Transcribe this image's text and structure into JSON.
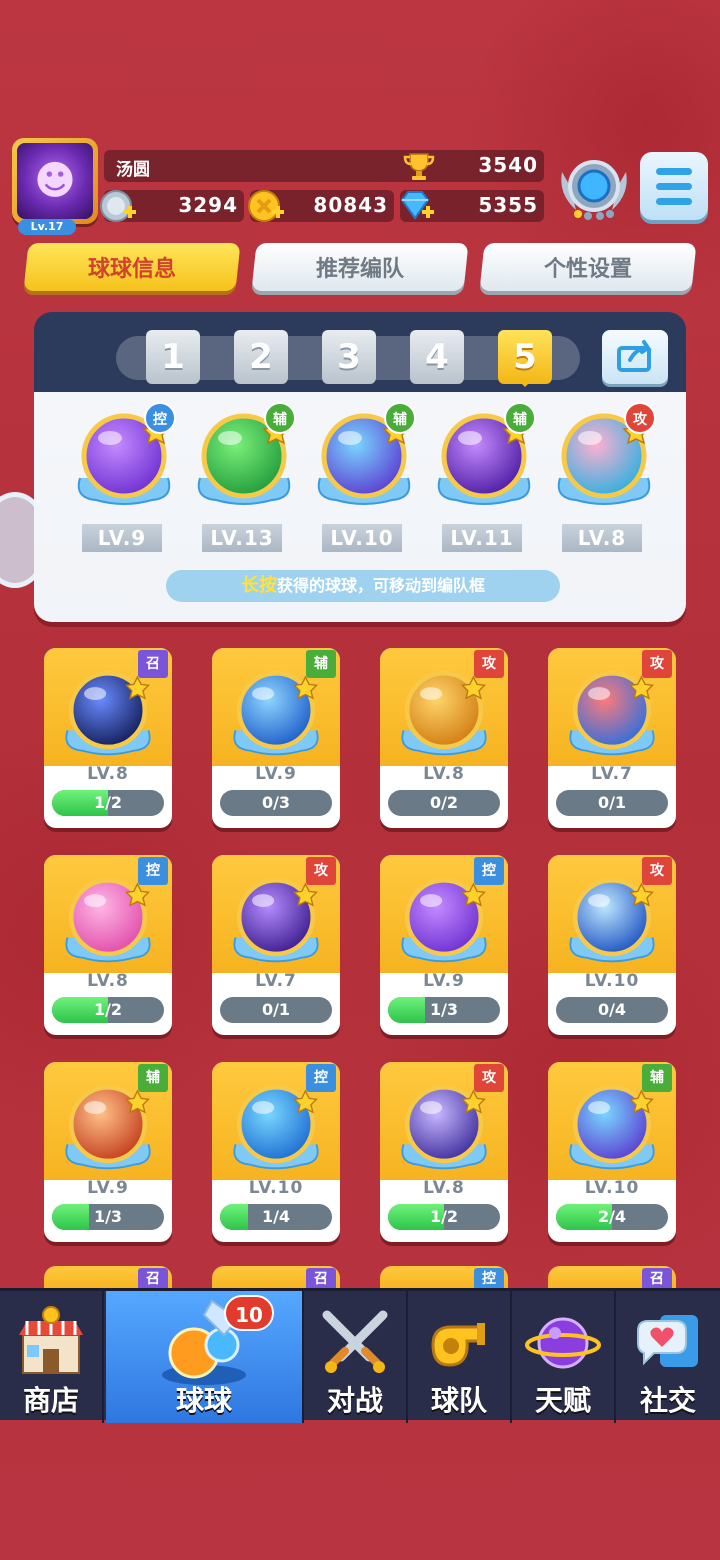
{
  "player": {
    "name": "汤圆",
    "level": "Lv.17",
    "trophies": "3540",
    "silver": "3294",
    "gold": "80843",
    "diamonds": "5355"
  },
  "tabs": [
    "球球信息",
    "推荐编队",
    "个性设置"
  ],
  "team": {
    "slots": [
      "1",
      "2",
      "3",
      "4",
      "5"
    ],
    "active_slot": "5",
    "balls": [
      {
        "tag": "控",
        "level": "LV.9",
        "icon": "butterfly-ball-icon"
      },
      {
        "tag": "辅",
        "level": "LV.13",
        "icon": "star-arrow-ball-icon"
      },
      {
        "tag": "辅",
        "level": "LV.10",
        "icon": "figures-ball-icon"
      },
      {
        "tag": "辅",
        "level": "LV.11",
        "icon": "leaf-ball-icon"
      },
      {
        "tag": "攻",
        "level": "LV.8",
        "icon": "prism-ball-icon"
      }
    ],
    "hint_highlight": "长按",
    "hint_text": "获得的球球，可移动到编队框"
  },
  "tag_colors": {
    "控": "#3a8fe0",
    "辅": "#4aad3a",
    "攻": "#e0453a",
    "召": "#7b55d9"
  },
  "cards": [
    {
      "tag": "召",
      "level": "LV.8",
      "progress": "1/2",
      "fill": 0.5,
      "icon": "void-ball-icon"
    },
    {
      "tag": "辅",
      "level": "LV.9",
      "progress": "0/3",
      "fill": 0,
      "icon": "ice-crystal-ball-icon"
    },
    {
      "tag": "攻",
      "level": "LV.8",
      "progress": "0/2",
      "fill": 0,
      "icon": "knight-ball-icon"
    },
    {
      "tag": "攻",
      "level": "LV.7",
      "progress": "0/1",
      "fill": 0,
      "icon": "yinyang-ball-icon"
    },
    {
      "tag": "控",
      "level": "LV.8",
      "progress": "1/2",
      "fill": 0.5,
      "icon": "heart-ball-icon"
    },
    {
      "tag": "攻",
      "level": "LV.7",
      "progress": "0/1",
      "fill": 0,
      "icon": "sword-ball-icon"
    },
    {
      "tag": "控",
      "level": "LV.9",
      "progress": "1/3",
      "fill": 0.33,
      "icon": "butterfly-ball-icon"
    },
    {
      "tag": "攻",
      "level": "LV.10",
      "progress": "0/4",
      "fill": 0,
      "icon": "vortex-ball-icon"
    },
    {
      "tag": "辅",
      "level": "LV.9",
      "progress": "1/3",
      "fill": 0.33,
      "icon": "wings-ball-icon"
    },
    {
      "tag": "控",
      "level": "LV.10",
      "progress": "1/4",
      "fill": 0.25,
      "icon": "cloud-ball-icon"
    },
    {
      "tag": "攻",
      "level": "LV.8",
      "progress": "1/2",
      "fill": 0.5,
      "icon": "pixel-ball-icon"
    },
    {
      "tag": "辅",
      "level": "LV.10",
      "progress": "2/4",
      "fill": 0.5,
      "icon": "figures-ball-icon"
    }
  ],
  "peek_tags": [
    "召",
    "召",
    "控",
    "召"
  ],
  "nav": {
    "items": [
      {
        "label": "商店",
        "icon": "shop-icon"
      },
      {
        "label": "球球",
        "icon": "balls-icon"
      },
      {
        "label": "对战",
        "icon": "crossed-swords-icon"
      },
      {
        "label": "球队",
        "icon": "whistle-icon"
      },
      {
        "label": "天赋",
        "icon": "planet-icon"
      },
      {
        "label": "社交",
        "icon": "chat-heart-icon"
      }
    ],
    "badge": "10"
  }
}
